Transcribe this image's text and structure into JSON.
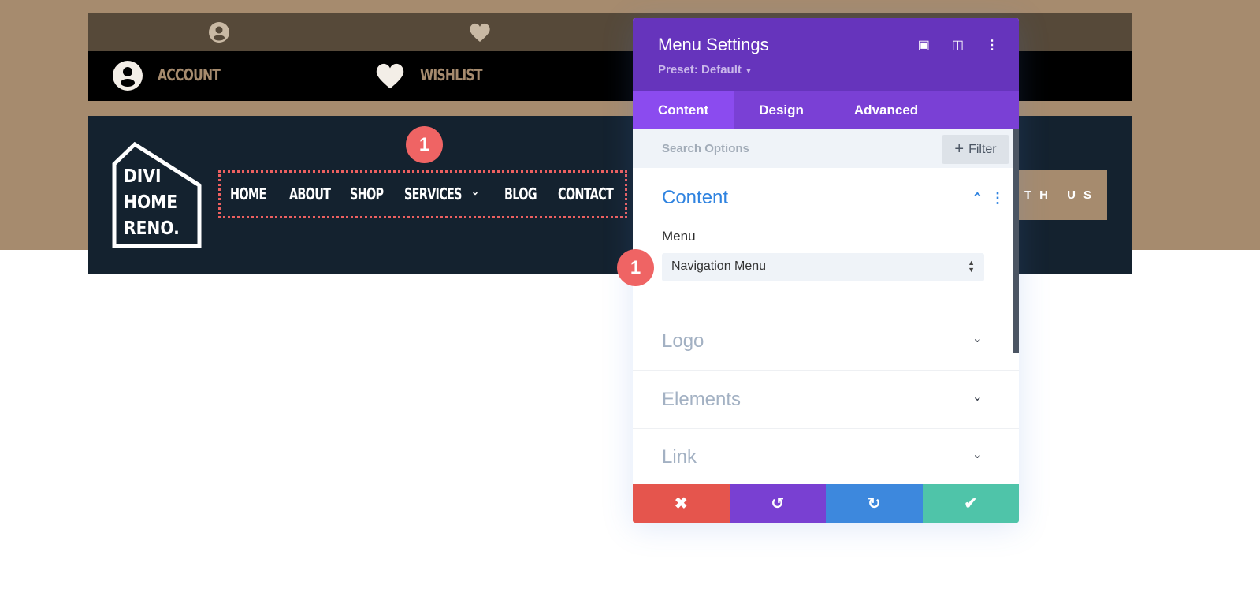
{
  "top_bar": {
    "account_label": "ACCOUNT",
    "wishlist_label": "WISHLIST"
  },
  "logo": {
    "line1": "DIVI",
    "line2": "HOME",
    "line3": "RENO."
  },
  "nav": {
    "items": [
      "HOME",
      "ABOUT",
      "SHOP",
      "SERVICES",
      "BLOG",
      "CONTACT"
    ],
    "dropdown_icon": "chevron-down-icon"
  },
  "cta": {
    "visible_label": "TH US"
  },
  "badges": {
    "nav_badge": "1",
    "select_badge": "1"
  },
  "panel": {
    "title": "Menu Settings",
    "preset": "Preset: Default",
    "tabs": [
      "Content",
      "Design",
      "Advanced"
    ],
    "active_tab": "Content",
    "search_placeholder": "Search Options",
    "filter_label": "Filter",
    "sections": {
      "content": "Content",
      "logo": "Logo",
      "elements": "Elements",
      "link": "Link"
    },
    "menu_label": "Menu",
    "menu_value": "Navigation Menu"
  },
  "colors": {
    "brand": "#a68b6e",
    "panel_header": "#6634bc",
    "tabs": "#7a40d5",
    "cancel": "#e5554d",
    "undo": "#7940d2",
    "redo": "#3d88dd",
    "save": "#4fc4a9"
  }
}
